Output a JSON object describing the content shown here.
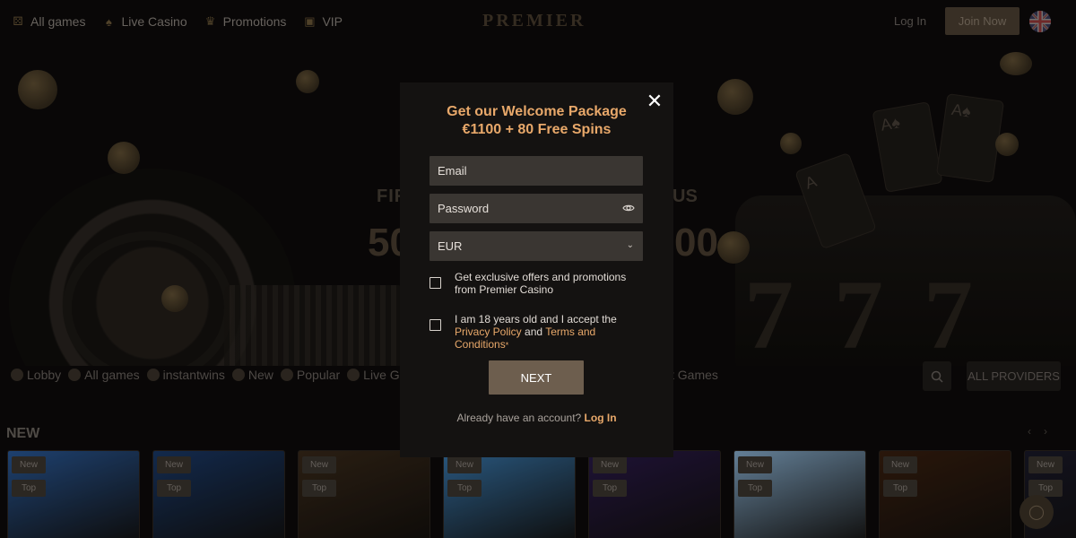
{
  "header": {
    "nav": [
      {
        "label": "All games",
        "icon": "dice-icon"
      },
      {
        "label": "Live Casino",
        "icon": "cards-icon"
      },
      {
        "label": "Promotions",
        "icon": "crown-icon"
      },
      {
        "label": "VIP",
        "icon": "gift-icon"
      }
    ],
    "logo": "PREMIER",
    "login": "Log In",
    "join": "Join Now",
    "language_flag": "uk-flag-icon"
  },
  "hero": {
    "line1_left": "FIR",
    "line1_right": "US",
    "line2_left": "50",
    "line2_right": "00"
  },
  "categories": {
    "items": [
      {
        "label": "Lobby"
      },
      {
        "label": "All games"
      },
      {
        "label": "instantwins"
      },
      {
        "label": "New"
      },
      {
        "label": "Popular"
      },
      {
        "label": "Live Games"
      }
    ],
    "partial_right": "t Games",
    "all_providers": "ALL PROVIDERS"
  },
  "section": {
    "title": "NEW",
    "prev_arrow": "‹",
    "next_arrow": "›"
  },
  "tiles": [
    {
      "tag1": "New",
      "tag2": "Top",
      "color": "#2a5a9a"
    },
    {
      "tag1": "New",
      "tag2": "Top",
      "color": "#1a3a6a"
    },
    {
      "tag1": "New",
      "tag2": "Top",
      "color": "#3a2a1a"
    },
    {
      "tag1": "New",
      "tag2": "Top",
      "color": "#3a7ab0"
    },
    {
      "tag1": "New",
      "tag2": "Top",
      "color": "#2a1a4a"
    },
    {
      "tag1": "New",
      "tag2": "Top",
      "color": "#8ab0d0"
    },
    {
      "tag1": "New",
      "tag2": "Top",
      "color": "#3a2010"
    },
    {
      "tag1": "New",
      "tag2": "Top",
      "color": "#1a1a2a"
    }
  ],
  "modal": {
    "title_line1": "Get our Welcome Package",
    "title_line2": "€1100 + 80 Free Spins",
    "email_placeholder": "Email",
    "password_placeholder": "Password",
    "currency_value": "EUR",
    "offers_text": "Get exclusive offers and promotions from Premier Casino",
    "age_text_prefix": "I am 18 years old and I accept the",
    "privacy_link": "Privacy Policy",
    "and_text": "and",
    "terms_link": "Terms and Conditions",
    "required_marker": "*",
    "next_label": "NEXT",
    "already_text": "Already have an account?",
    "login_link": "Log In",
    "accent_color": "#e8a86a"
  }
}
